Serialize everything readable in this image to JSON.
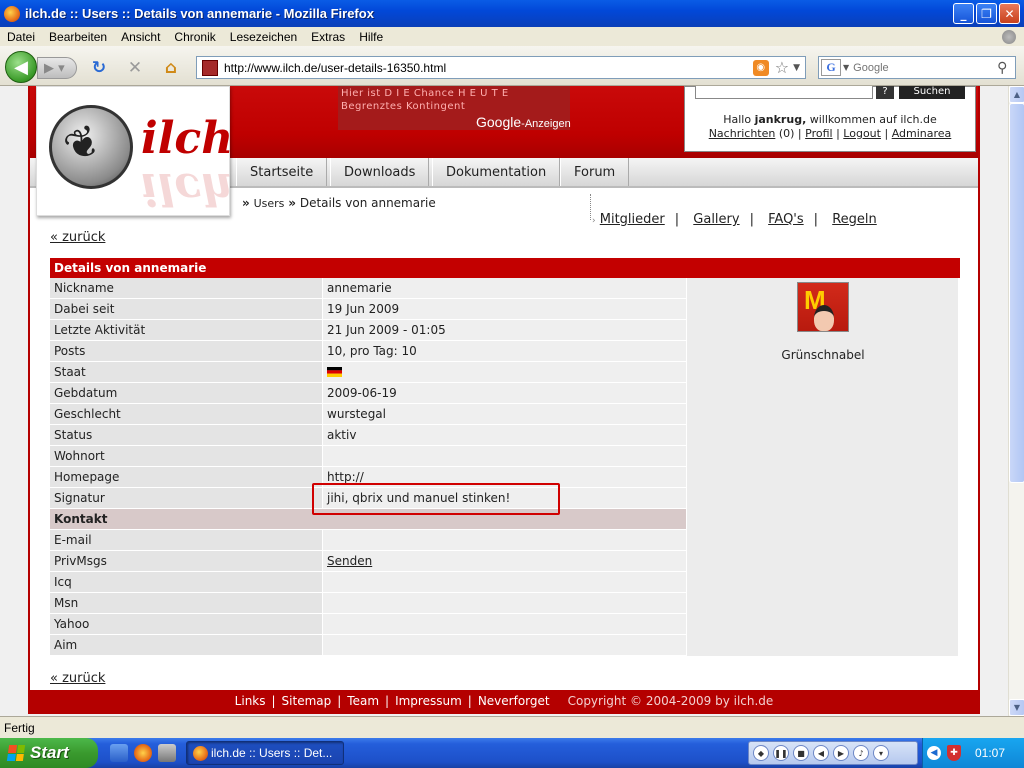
{
  "window": {
    "title": "ilch.de :: Users :: Details von annemarie - Mozilla Firefox",
    "minimize": "_",
    "maximize": "❐",
    "close": "✕"
  },
  "menu": [
    "Datei",
    "Bearbeiten",
    "Ansicht",
    "Chronik",
    "Lesezeichen",
    "Extras",
    "Hilfe"
  ],
  "toolbar": {
    "url": "http://www.ilch.de/user-details-16350.html",
    "search_engine": "G",
    "search_placeholder": "Google"
  },
  "site": {
    "logo_text": "ilch",
    "ad_line1": "Hier ist D I E Chance H E U T E",
    "ad_line2": "Begrenztes Kontingent",
    "ad_google": "Google",
    "ad_suffix": "-Anzeigen",
    "search_help": "?",
    "search_button": "Suchen",
    "greeting_prefix": "Hallo ",
    "greeting_user": "jankrug,",
    "greeting_suffix": " willkommen auf ilch.de",
    "user_links": {
      "nachrichten": "Nachrichten",
      "nachrichten_count": " (0) ",
      "profil": "Profil",
      "logout": "Logout",
      "adminarea": "Adminarea",
      "sep": "|"
    },
    "nav": [
      "Startseite",
      "Downloads",
      "Dokumentation",
      "Forum"
    ],
    "breadcrumb": {
      "arrow": "»",
      "users": "Users",
      "current": "Details von annemarie"
    },
    "sublinks": [
      "Mitglieder",
      "Gallery",
      "FAQ's",
      "Regeln"
    ],
    "sublink_sep": "|",
    "back_link": "« zurück"
  },
  "details": {
    "header": "Details von annemarie",
    "rows": [
      {
        "label": "Nickname",
        "value": "annemarie"
      },
      {
        "label": "Dabei seit",
        "value": "19 Jun 2009"
      },
      {
        "label": "Letzte Aktivität",
        "value": "21 Jun 2009 - 01:05"
      },
      {
        "label": "Posts",
        "value": "10, pro Tag: 10"
      },
      {
        "label": "Staat",
        "value": ""
      },
      {
        "label": "Gebdatum",
        "value": "2009-06-19"
      },
      {
        "label": "Geschlecht",
        "value": "wurstegal"
      },
      {
        "label": "Status",
        "value": "aktiv"
      },
      {
        "label": "Wohnort",
        "value": ""
      },
      {
        "label": "Homepage",
        "value": "http://"
      },
      {
        "label": "Signatur",
        "value": "jihi, qbrix und manuel stinken!"
      }
    ],
    "contact_header": "Kontakt",
    "contact_rows": [
      {
        "label": "E-mail",
        "value": ""
      },
      {
        "label": "PrivMsgs",
        "value": "Senden"
      },
      {
        "label": "Icq",
        "value": ""
      },
      {
        "label": "Msn",
        "value": ""
      },
      {
        "label": "Yahoo",
        "value": ""
      },
      {
        "label": "Aim",
        "value": ""
      }
    ],
    "rank": "Grünschnabel",
    "flag": "germany-flag-icon"
  },
  "footer": {
    "links": [
      "Links",
      "Sitemap",
      "Team",
      "Impressum",
      "Neverforget"
    ],
    "sep": "|",
    "copyright": "Copyright © 2004-2009 by ilch.de"
  },
  "statusbar": {
    "text": "Fertig"
  },
  "taskbar": {
    "start": "Start",
    "task_label": "ilch.de :: Users :: Det...",
    "clock": "01:07"
  },
  "colors": {
    "brand_red": "#c30000",
    "highlight": "#d00000"
  }
}
